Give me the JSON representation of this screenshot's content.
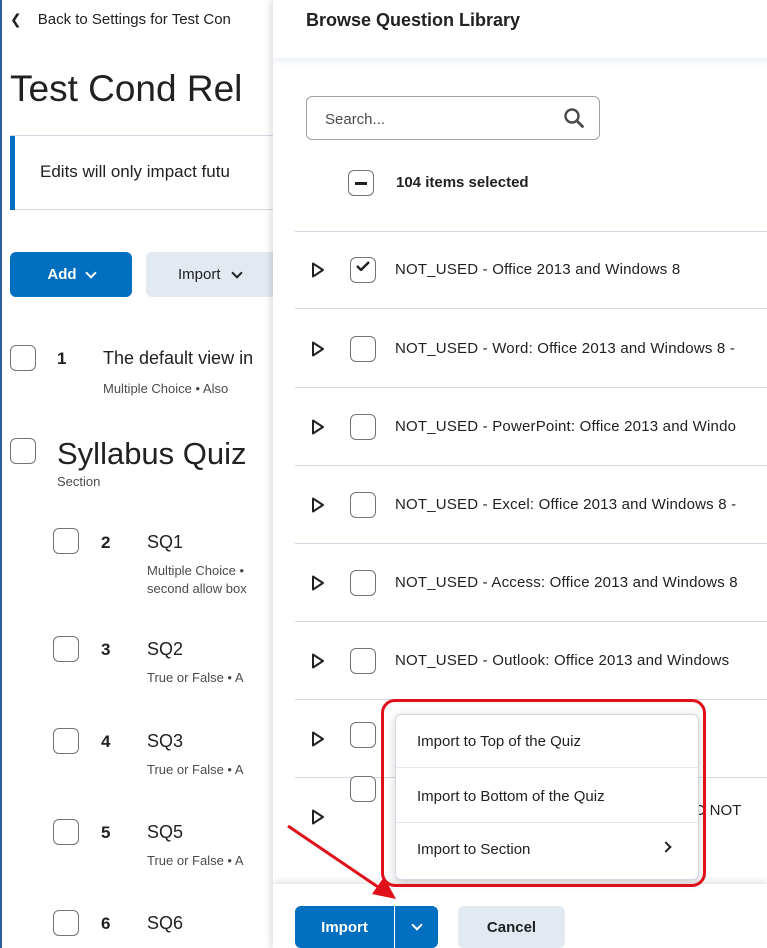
{
  "left": {
    "back_label": "Back to Settings for Test Con",
    "title": "Test Cond Rel",
    "alert": "Edits will only impact futu",
    "add_label": "Add",
    "import_label": "Import",
    "questions": [
      {
        "num": "1",
        "title": "The default view in",
        "meta": "Multiple Choice  •  Also"
      },
      {
        "num": "2",
        "title": "SQ1",
        "meta": "Multiple Choice  •",
        "meta2": "second allow box"
      },
      {
        "num": "3",
        "title": "SQ2",
        "meta": "True or False  •  A"
      },
      {
        "num": "4",
        "title": "SQ3",
        "meta": "True or False  •  A"
      },
      {
        "num": "5",
        "title": "SQ5",
        "meta": "True or False  •  A"
      },
      {
        "num": "6",
        "title": "SQ6",
        "meta": ""
      }
    ],
    "section_title": "Syllabus Quiz",
    "section_sub": "Section"
  },
  "dialog": {
    "title": "Browse Question Library",
    "search_placeholder": "Search...",
    "selected_text": "104 items selected",
    "rows": [
      {
        "label": "NOT_USED - Office 2013 and Windows 8",
        "checked": true
      },
      {
        "label": "NOT_USED - Word: Office 2013 and Windows 8 -",
        "checked": false
      },
      {
        "label": "NOT_USED - PowerPoint: Office 2013 and Windo",
        "checked": false
      },
      {
        "label": "NOT_USED - Excel: Office 2013 and Windows 8 -",
        "checked": false
      },
      {
        "label": "NOT_USED - Access: Office 2013 and Windows 8",
        "checked": false
      },
      {
        "label": "NOT_USED - Outlook: Office 2013 and Windows",
        "checked": false
      },
      {
        "label": "",
        "checked": false
      },
      {
        "label": "DO NOT",
        "checked": false
      }
    ],
    "import_label": "Import",
    "cancel_label": "Cancel"
  },
  "menu": {
    "items": [
      "Import to Top of the Quiz",
      "Import to Bottom of the Quiz",
      "Import to Section"
    ]
  },
  "colors": {
    "primary": "#006fbf",
    "highlight": "#e0101b",
    "secondary_button": "#e3e9f1"
  }
}
